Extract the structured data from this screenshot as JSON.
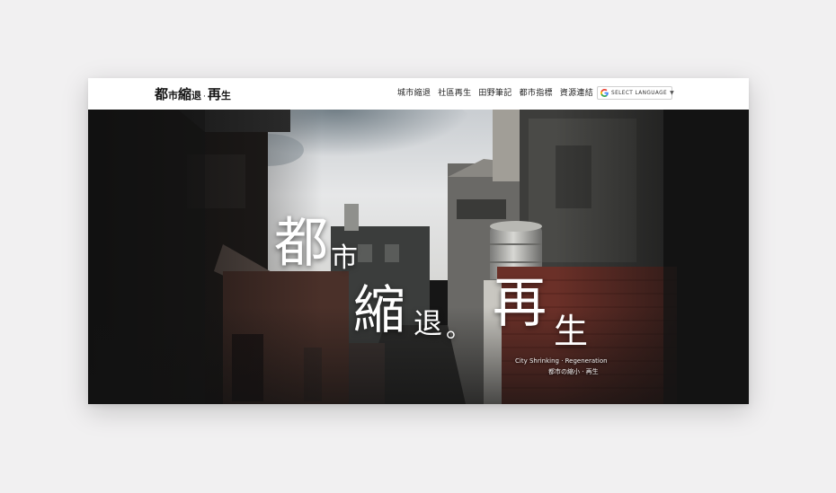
{
  "header": {
    "logo": {
      "part1_big": "都",
      "part1_small": "市",
      "part2_big": "縮",
      "part2_small": "退",
      "separator": "·",
      "part3_big": "再",
      "part3_small": "生"
    },
    "nav": [
      {
        "label": "城市縮退"
      },
      {
        "label": "社區再生"
      },
      {
        "label": "田野筆記"
      },
      {
        "label": "都市指標"
      },
      {
        "label": "資源連結"
      }
    ],
    "language_select": {
      "label": "SELECT LANGUAGE",
      "icon": "google-g-icon",
      "caret": "▼"
    }
  },
  "hero": {
    "title": {
      "c1": "都",
      "c2": "市",
      "c3": "縮",
      "c4": "退",
      "c5": "。",
      "c6": "再",
      "c7": "生"
    },
    "subtitle_en": "City Shrinking · Regeneration",
    "subtitle_zh": "都市の縮小 · 再生"
  },
  "colors": {
    "page_background": "#f1f0f1",
    "header_background": "#ffffff",
    "hero_background": "#141414",
    "title_text": "#ffffff"
  }
}
